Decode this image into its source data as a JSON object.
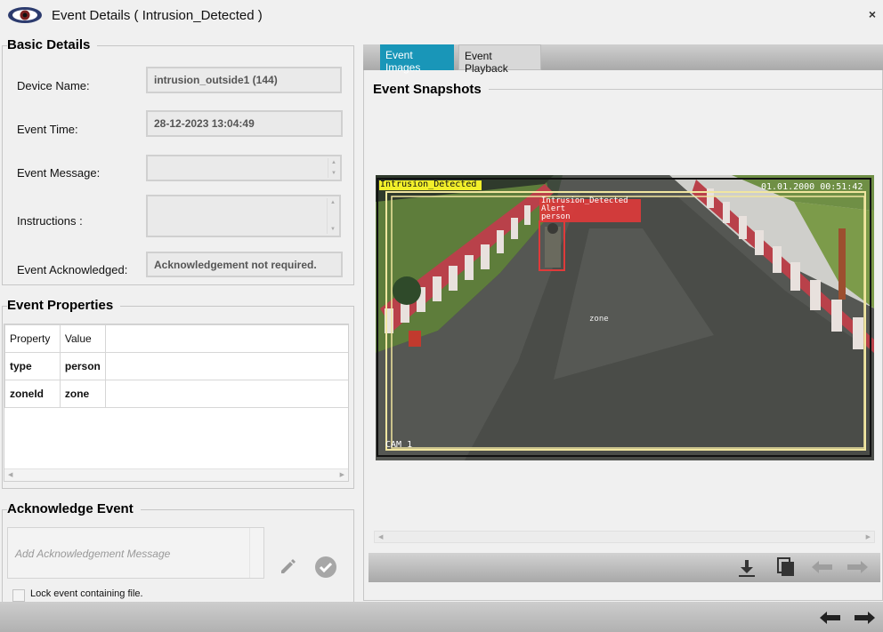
{
  "window": {
    "title": "Event Details ( Intrusion_Detected )",
    "close": "×"
  },
  "basic_details": {
    "title": "Basic Details",
    "device_name_label": "Device Name:",
    "device_name_value": "intrusion_outside1 (144)",
    "event_time_label": "Event Time:",
    "event_time_value": "28-12-2023 13:04:49",
    "event_message_label": "Event Message:",
    "event_message_value": "",
    "instructions_label": "Instructions :",
    "instructions_value": "",
    "event_ack_label": "Event Acknowledged:",
    "event_ack_value": "Acknowledgement not required."
  },
  "event_properties": {
    "title": "Event Properties",
    "columns": [
      "Property",
      "Value"
    ],
    "rows": [
      {
        "property": "type",
        "value": "person"
      },
      {
        "property": "zoneId",
        "value": "zone"
      }
    ]
  },
  "acknowledge": {
    "title": "Acknowledge Event",
    "placeholder": "Add Acknowledgement Message",
    "lock_label": "Lock event containing file."
  },
  "tabs": [
    {
      "label": "Event Images",
      "active": true
    },
    {
      "label": "Event Playback",
      "active": false
    }
  ],
  "snapshots": {
    "title": "Event Snapshots",
    "overlay_top_left": "Intrusion_Detected",
    "overlay_timestamp": "01.01.2000 00:51:42",
    "overlay_alert": [
      "Intrusion_Detected",
      "Alert",
      "person"
    ],
    "overlay_zone": "zone",
    "overlay_cam": "CAM 1"
  },
  "icons": {
    "eye": "eye-icon",
    "download": "download-icon",
    "copy": "copy-icon",
    "prev": "arrow-left-icon",
    "next": "arrow-right-icon",
    "edit": "pencil-icon",
    "confirm": "check-circle-icon"
  },
  "colors": {
    "accent_tab": "#1996b8",
    "alert_red": "#e03a3a",
    "zone_yellow": "#f1e6a0"
  }
}
